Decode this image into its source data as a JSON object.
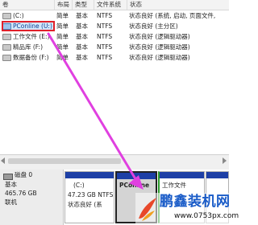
{
  "volume_list": {
    "columns": [
      "卷",
      "布局",
      "类型",
      "文件系统",
      "状态"
    ],
    "rows": [
      {
        "volume": "(C:)",
        "layout": "简单",
        "type": "基本",
        "fs": "NTFS",
        "status": "状态良好 (系统, 启动, 页面文件,",
        "icon": "drive-gray-icon"
      },
      {
        "volume": "PConline (U:)",
        "layout": "简单",
        "type": "基本",
        "fs": "NTFS",
        "status": "状态良好 (主分区)",
        "icon": "drive-blue-icon"
      },
      {
        "volume": "工作文件 (E:)",
        "layout": "简单",
        "type": "基本",
        "fs": "NTFS",
        "status": "状态良好 (逻辑驱动器)",
        "icon": "drive-gray-icon"
      },
      {
        "volume": "精品库 (F:)",
        "layout": "简单",
        "type": "基本",
        "fs": "NTFS",
        "status": "状态良好 (逻辑驱动器)",
        "icon": "drive-gray-icon"
      },
      {
        "volume": "数据备份 (F:)",
        "layout": "简单",
        "type": "基本",
        "fs": "NTFS",
        "status": "状态良好 (逻辑驱动器)",
        "icon": "drive-gray-icon"
      }
    ]
  },
  "disk": {
    "name": "磁盘 0",
    "type": "基本",
    "size": "465.76 GB",
    "state": "联机",
    "icon": "disk-icon"
  },
  "partitions": [
    {
      "name": "(C:)",
      "size": "47.23 GB NTFS",
      "status": "状态良好 (系"
    },
    {
      "name": "PConline",
      "size": "",
      "status": ""
    },
    {
      "name": "工作文件",
      "size": "",
      "status": ""
    }
  ],
  "watermark": {
    "title": "鹏鑫装机网",
    "url": "www.0753px.com"
  },
  "colors": {
    "selection_border": "#e0202a",
    "arrow": "#e040e0",
    "primary_bar": "#1d3fa6",
    "logical_bar": "#2c9b2c"
  }
}
